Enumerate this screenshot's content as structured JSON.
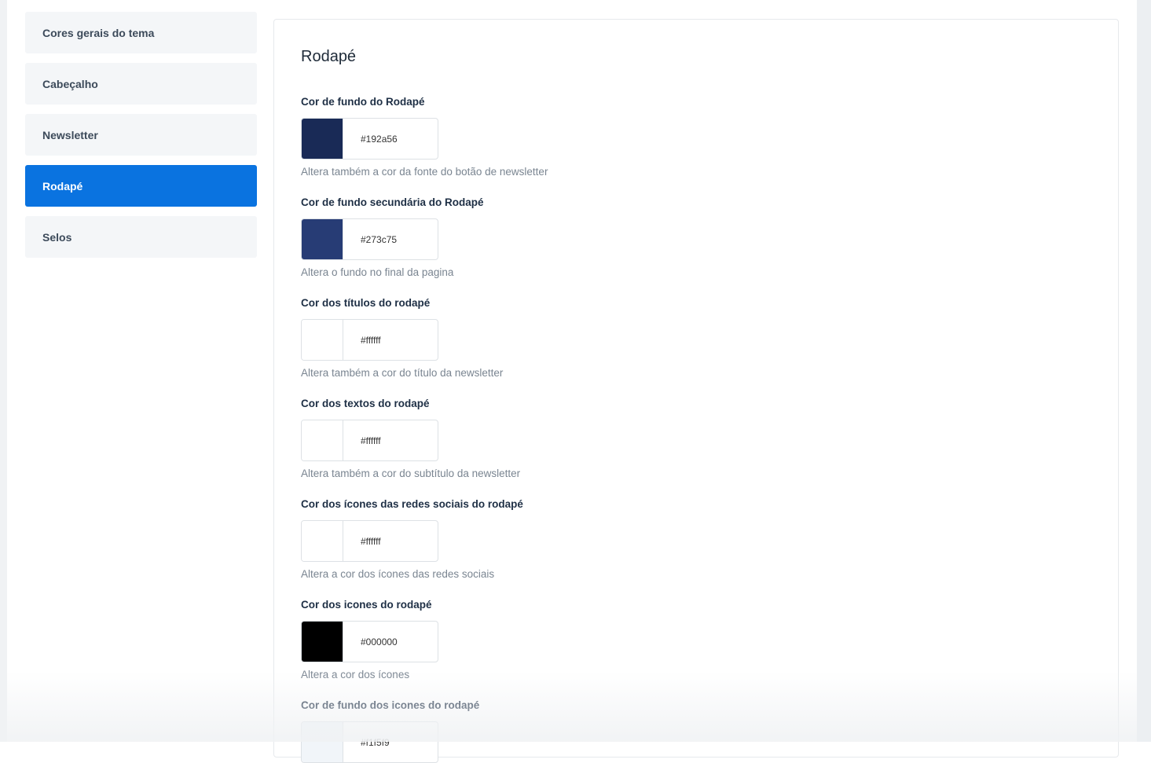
{
  "sidebar": {
    "items": [
      {
        "label": "Cores gerais do tema"
      },
      {
        "label": "Cabeçalho"
      },
      {
        "label": "Newsletter"
      },
      {
        "label": "Rodapé"
      },
      {
        "label": "Selos"
      }
    ]
  },
  "panel": {
    "title": "Rodapé",
    "fields": [
      {
        "label": "Cor de fundo do Rodapé",
        "value": "#192a56",
        "help": "Altera também a cor da fonte do botão de newsletter"
      },
      {
        "label": "Cor de fundo secundária do Rodapé",
        "value": "#273c75",
        "help": "Altera o fundo no final da pagina"
      },
      {
        "label": "Cor dos títulos do rodapé",
        "value": "#ffffff",
        "help": "Altera também a cor do título da newsletter"
      },
      {
        "label": "Cor dos textos do rodapé",
        "value": "#ffffff",
        "help": "Altera também a cor do subtítulo da newsletter"
      },
      {
        "label": "Cor dos ícones das redes sociais do rodapé",
        "value": "#ffffff",
        "help": "Altera a cor dos ícones das redes sociais"
      },
      {
        "label": "Cor dos icones do rodapé",
        "value": "#000000",
        "help": "Altera a cor dos ícones"
      },
      {
        "label": "Cor de fundo dos icones do rodapé",
        "value": "#f1f5f9",
        "help": ""
      }
    ]
  },
  "colors": {
    "accent": "#0a73e0"
  }
}
